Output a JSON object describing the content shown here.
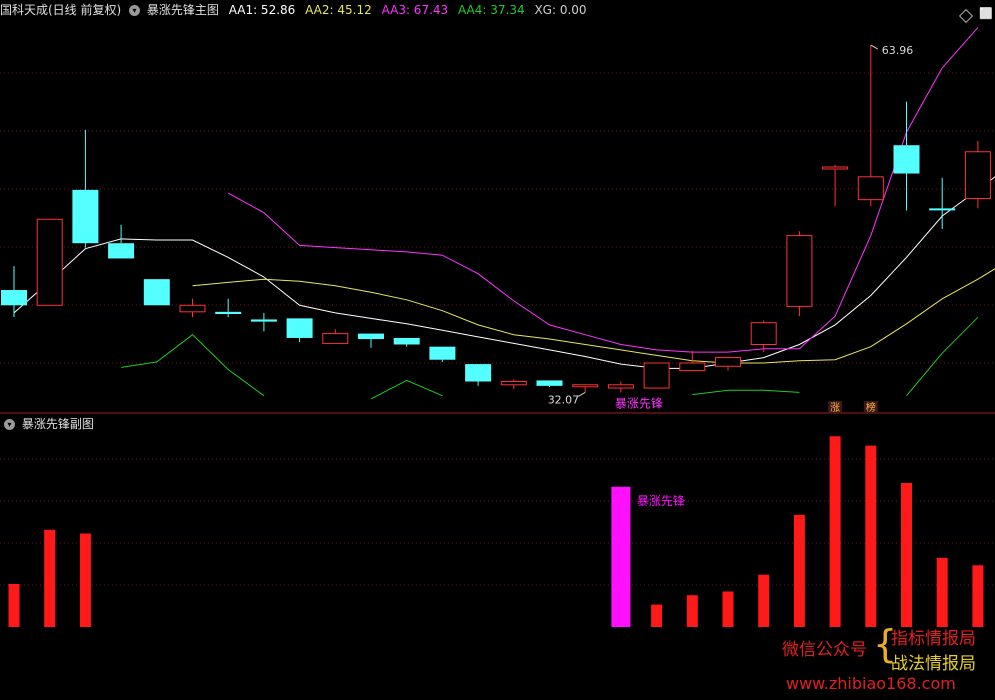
{
  "header": {
    "security_name": "国科天成(日线 前复权)",
    "indicator_name": "暴涨先锋主图",
    "aa1_label": "AA1: 52.86",
    "aa2_label": "AA2: 45.12",
    "aa3_label": "AA3: 67.43",
    "aa4_label": "AA4: 37.34",
    "xg_label": "XG: 0.00"
  },
  "sub_panel": {
    "title": "暴涨先锋副图"
  },
  "colors": {
    "up": "#ff3232",
    "down": "#54ffff",
    "aa1": "#ffffff",
    "aa2": "#e8e85a",
    "aa3": "#ff33ff",
    "aa4": "#22cc22",
    "grid": "#7a1414",
    "sub_bar": "#ff1a1a",
    "sub_signal": "#ff11ff"
  },
  "chart_data": [
    {
      "type": "candlestick",
      "name": "暴涨先锋主图",
      "ylim": [
        30.8,
        66.8
      ],
      "candles": [
        {
          "o": 42.0,
          "h": 44.2,
          "l": 39.5,
          "c": 40.6
        },
        {
          "o": 40.6,
          "h": 48.5,
          "l": 40.6,
          "c": 48.5
        },
        {
          "o": 51.2,
          "h": 56.7,
          "l": 45.9,
          "c": 46.3
        },
        {
          "o": 46.3,
          "h": 48.0,
          "l": 44.9,
          "c": 44.9
        },
        {
          "o": 43.0,
          "h": 43.0,
          "l": 40.6,
          "c": 40.6
        },
        {
          "o": 40.0,
          "h": 41.2,
          "l": 39.5,
          "c": 40.6
        },
        {
          "o": 40.0,
          "h": 41.2,
          "l": 39.5,
          "c": 39.8
        },
        {
          "o": 39.3,
          "h": 39.9,
          "l": 38.2,
          "c": 39.1
        },
        {
          "o": 39.4,
          "h": 39.4,
          "l": 37.2,
          "c": 37.6
        },
        {
          "o": 37.1,
          "h": 38.4,
          "l": 37.1,
          "c": 38.0
        },
        {
          "o": 38.0,
          "h": 38.0,
          "l": 36.7,
          "c": 37.5
        },
        {
          "o": 37.6,
          "h": 37.6,
          "l": 36.8,
          "c": 37.0
        },
        {
          "o": 36.8,
          "h": 36.8,
          "l": 35.4,
          "c": 35.6
        },
        {
          "o": 35.2,
          "h": 35.2,
          "l": 33.2,
          "c": 33.6
        },
        {
          "o": 33.3,
          "h": 33.8,
          "l": 32.9,
          "c": 33.6
        },
        {
          "o": 33.7,
          "h": 33.7,
          "l": 33.1,
          "c": 33.2
        },
        {
          "o": 33.3,
          "h": 33.3,
          "l": 32.6,
          "c": 33.3
        },
        {
          "o": 33.0,
          "h": 33.6,
          "l": 32.6,
          "c": 33.3
        },
        {
          "o": 33.0,
          "h": 35.3,
          "l": 33.0,
          "c": 35.3
        },
        {
          "o": 34.6,
          "h": 36.4,
          "l": 34.6,
          "c": 35.3
        },
        {
          "o": 35.0,
          "h": 35.8,
          "l": 34.6,
          "c": 35.8
        },
        {
          "o": 37.0,
          "h": 39.2,
          "l": 36.3,
          "c": 39.0
        },
        {
          "o": 40.5,
          "h": 47.4,
          "l": 39.6,
          "c": 47.0
        },
        {
          "o": 53.3,
          "h": 53.5,
          "l": 49.7,
          "c": 53.3
        },
        {
          "o": 50.3,
          "h": 64.5,
          "l": 49.7,
          "c": 52.4
        },
        {
          "o": 55.3,
          "h": 59.3,
          "l": 49.3,
          "c": 52.7
        },
        {
          "o": 49.5,
          "h": 52.3,
          "l": 47.6,
          "c": 49.4
        },
        {
          "o": 50.4,
          "h": 55.7,
          "l": 49.5,
          "c": 54.7
        }
      ],
      "series": [
        {
          "name": "AA1",
          "start": 0,
          "values": [
            39.9,
            42.8,
            45.8,
            46.7,
            46.6,
            46.6,
            45.0,
            43.2,
            40.6,
            39.9,
            39.4,
            38.9,
            38.3,
            37.7,
            37.1,
            36.5,
            35.9,
            35.2,
            34.8,
            34.8,
            35.3,
            35.8,
            37.0,
            38.8,
            41.5,
            45.0,
            48.8,
            51.2,
            53.7
          ]
        },
        {
          "name": "AA2",
          "start": 5,
          "values": [
            42.4,
            42.7,
            43.0,
            42.8,
            42.4,
            41.8,
            41.1,
            40.1,
            38.8,
            37.9,
            37.5,
            37.0,
            36.5,
            36.0,
            35.5,
            35.3,
            35.3,
            35.5,
            35.6,
            36.8,
            38.9,
            41.2,
            43.0,
            45.0,
            46.9
          ]
        },
        {
          "name": "AA3",
          "start": 6,
          "values": [
            50.9,
            49.1,
            46.1,
            45.9,
            45.7,
            45.5,
            45.2,
            43.5,
            41.0,
            38.8,
            37.9,
            37.0,
            36.5,
            36.3,
            36.3,
            36.6,
            36.6,
            39.6,
            47.0,
            56.5,
            62.4,
            66.1
          ]
        },
        {
          "name": "AA4",
          "segments": [
            {
              "start": 3,
              "values": [
                34.9,
                35.4,
                37.9,
                34.7,
                32.3
              ]
            },
            {
              "start": 10,
              "values": [
                32.0,
                33.7,
                32.3
              ]
            },
            {
              "start": 19,
              "values": [
                32.4,
                32.8,
                32.8,
                32.6
              ]
            },
            {
              "start": 25,
              "values": [
                32.3,
                36.2,
                39.5
              ]
            }
          ]
        }
      ],
      "annotations": [
        {
          "type": "max",
          "text": "63.96",
          "index": 24
        },
        {
          "type": "min",
          "text": "32.07",
          "index": 16
        },
        {
          "type": "signal",
          "text": "暴涨先锋",
          "index": 17
        }
      ],
      "markers": [
        {
          "index": 23,
          "text": "涨"
        },
        {
          "index": 24,
          "text": "榜"
        }
      ]
    },
    {
      "type": "bar",
      "name": "暴涨先锋副图",
      "ylim": [
        0,
        100
      ],
      "values": [
        23,
        52,
        50,
        0,
        0,
        0,
        0,
        0,
        0,
        0,
        0,
        0,
        0,
        0,
        0,
        0,
        0,
        75,
        12,
        17,
        19,
        28,
        60,
        102,
        97,
        77,
        37,
        33
      ],
      "signal_index": 17,
      "signal_label": "暴涨先锋"
    }
  ],
  "watermark": {
    "left": "微信公众号",
    "brace": "{",
    "right_top": "指标情报局",
    "right_bottom": "战法情报局",
    "url": "www.zhibiao168.com"
  }
}
